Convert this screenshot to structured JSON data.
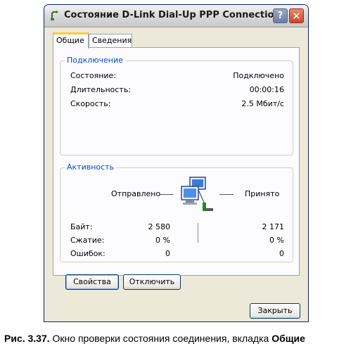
{
  "window": {
    "title": "Состояние D-Link Dial-Up PPP Connection",
    "help_label": "?",
    "close_label": "✕"
  },
  "tabs": [
    {
      "label": "Общие",
      "active": true
    },
    {
      "label": "Сведения",
      "active": false
    }
  ],
  "connection": {
    "legend": "Подключение",
    "rows": [
      {
        "label": "Состояние:",
        "value": "Подключено"
      },
      {
        "label": "Длительность:",
        "value": "00:00:16"
      },
      {
        "label": "Скорость:",
        "value": "2.5 Мбит/с"
      }
    ]
  },
  "activity": {
    "legend": "Активность",
    "sent_label": "Отправлено",
    "received_label": "Принято",
    "rows": [
      {
        "label": "Байт:",
        "sent": "2 580",
        "received": "2 171"
      },
      {
        "label": "Сжатие:",
        "sent": "0 %",
        "received": "0 %"
      },
      {
        "label": "Ошибок:",
        "sent": "0",
        "received": "0"
      }
    ]
  },
  "buttons": {
    "properties": "Свойства",
    "disconnect": "Отключить",
    "close": "Закрыть"
  },
  "caption": {
    "prefix": "Рис. 3.37.",
    "text": " Окно проверки состояния соединения, вкладка ",
    "bold": "Общие"
  }
}
